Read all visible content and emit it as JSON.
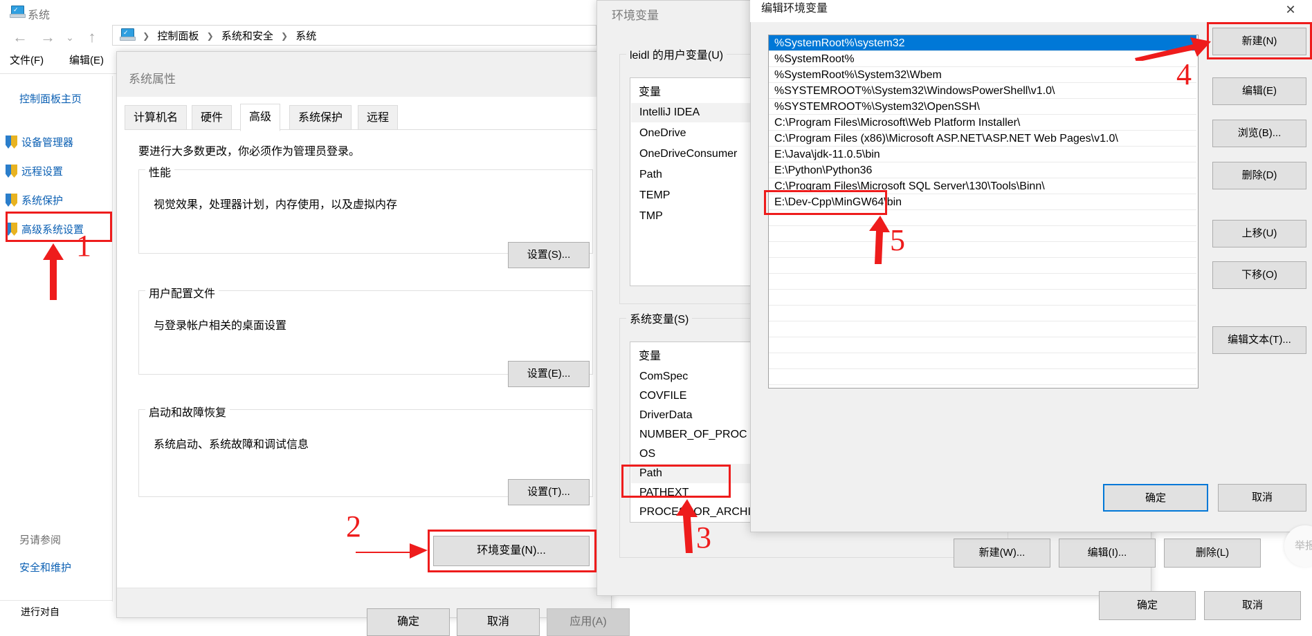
{
  "explorer": {
    "title": "系统",
    "nav": {
      "back": "←",
      "forward": "→",
      "recent": "⌄",
      "up": "↑"
    },
    "breadcrumbs": [
      "控制面板",
      "系统和安全",
      "系统"
    ],
    "menu": [
      "文件(F)",
      "编辑(E)"
    ],
    "sidebar": {
      "home": "控制面板主页",
      "items": [
        {
          "label": "设备管理器"
        },
        {
          "label": "远程设置"
        },
        {
          "label": "系统保护"
        },
        {
          "label": "高级系统设置"
        }
      ],
      "see_also_heading": "另请参阅",
      "see_also_items": [
        "安全和维护"
      ]
    },
    "status_text": "进行对自"
  },
  "system_properties": {
    "title": "系统属性",
    "tabs": [
      {
        "label": "计算机名",
        "active": false
      },
      {
        "label": "硬件",
        "active": false
      },
      {
        "label": "高级",
        "active": true
      },
      {
        "label": "系统保护",
        "active": false
      },
      {
        "label": "远程",
        "active": false
      }
    ],
    "admin_note": "要进行大多数更改，你必须作为管理员登录。",
    "groups": [
      {
        "label": "性能",
        "desc": "视觉效果，处理器计划，内存使用，以及虚拟内存",
        "button": "设置(S)..."
      },
      {
        "label": "用户配置文件",
        "desc": "与登录帐户相关的桌面设置",
        "button": "设置(E)..."
      },
      {
        "label": "启动和故障恢复",
        "desc": "系统启动、系统故障和调试信息",
        "button": "设置(T)..."
      }
    ],
    "env_button": "环境变量(N)...",
    "footer_buttons": [
      {
        "label": "确定",
        "disabled": false
      },
      {
        "label": "取消",
        "disabled": false
      },
      {
        "label": "应用(A)",
        "disabled": true
      }
    ]
  },
  "environment_variables": {
    "title": "环境变量",
    "user_section_label": "leidl 的用户变量(U)",
    "user_column_header": "变量",
    "user_variables": [
      "IntelliJ IDEA",
      "OneDrive",
      "OneDriveConsumer",
      "Path",
      "TEMP",
      "TMP"
    ],
    "user_selected": "IntelliJ IDEA",
    "system_section_label": "系统变量(S)",
    "system_column_header": "变量",
    "system_variables": [
      "ComSpec",
      "COVFILE",
      "DriverData",
      "NUMBER_OF_PROC",
      "OS",
      "Path",
      "PATHEXT",
      "PROCESSOR_ARCHI"
    ],
    "system_selected": "Path",
    "buttons": {
      "new": "新建(W)...",
      "edit": "编辑(I)...",
      "delete": "删除(L)"
    },
    "footer": {
      "ok": "确定",
      "cancel": "取消"
    }
  },
  "edit_environment_variable": {
    "title": "编辑环境变量",
    "close_icon": "✕",
    "paths": [
      "%SystemRoot%\\system32",
      "%SystemRoot%",
      "%SystemRoot%\\System32\\Wbem",
      "%SYSTEMROOT%\\System32\\WindowsPowerShell\\v1.0\\",
      "%SYSTEMROOT%\\System32\\OpenSSH\\",
      "C:\\Program Files\\Microsoft\\Web Platform Installer\\",
      "C:\\Program Files (x86)\\Microsoft ASP.NET\\ASP.NET Web Pages\\v1.0\\",
      "E:\\Java\\jdk-11.0.5\\bin",
      "E:\\Python\\Python36",
      "C:\\Program Files\\Microsoft SQL Server\\130\\Tools\\Binn\\",
      "E:\\Dev-Cpp\\MinGW64\\bin"
    ],
    "selected_index": 0,
    "highlighted_index": 10,
    "side_buttons": [
      "新建(N)",
      "编辑(E)",
      "浏览(B)...",
      "删除(D)",
      "上移(U)",
      "下移(O)",
      "编辑文本(T)..."
    ],
    "footer": {
      "ok": "确定",
      "cancel": "取消"
    }
  },
  "annotations": {
    "markers": [
      "1",
      "2",
      "3",
      "4",
      "5"
    ],
    "color": "#ee1c1c"
  },
  "report_badge": "举报"
}
